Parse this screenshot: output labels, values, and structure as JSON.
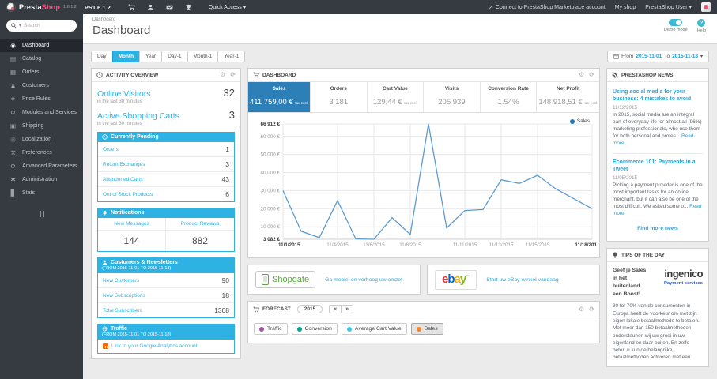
{
  "topbar": {
    "brand_presta": "Presta",
    "brand_shop": "Shop",
    "brand_version": "1.6.1.2",
    "ps_version": "PS1.6.1.2",
    "quick_access_label": "Quick Access ▾",
    "marketplace_link": "Connect to PrestaShop Marketplace account",
    "my_shop_link": "My shop",
    "user_label": "PrestaShop User ▾"
  },
  "sidebar": {
    "search_placeholder": "Search",
    "items": [
      {
        "label": "Dashboard",
        "icon": "gauge-icon",
        "glyph": "◉"
      },
      {
        "label": "Catalog",
        "icon": "book-icon",
        "glyph": "▤"
      },
      {
        "label": "Orders",
        "icon": "orders-icon",
        "glyph": "▦"
      },
      {
        "label": "Customers",
        "icon": "customers-icon",
        "glyph": "♟"
      },
      {
        "label": "Price Rules",
        "icon": "tag-icon",
        "glyph": "❖"
      },
      {
        "label": "Modules and Services",
        "icon": "puzzle-icon",
        "glyph": "⚙"
      },
      {
        "label": "Shipping",
        "icon": "truck-icon",
        "glyph": "▣"
      },
      {
        "label": "Localization",
        "icon": "globe-icon",
        "glyph": "◎"
      },
      {
        "label": "Preferences",
        "icon": "wrench-icon",
        "glyph": "⚒"
      },
      {
        "label": "Advanced Parameters",
        "icon": "gears-icon",
        "glyph": "⚙"
      },
      {
        "label": "Administration",
        "icon": "admin-gear-icon",
        "glyph": "✱"
      },
      {
        "label": "Stats",
        "icon": "stats-icon",
        "glyph": "▊"
      }
    ]
  },
  "header": {
    "breadcrumb": "Dashboard",
    "title": "Dashboard",
    "demo_mode_label": "Demo mode",
    "help_label": "Help"
  },
  "filters": {
    "ranges": [
      "Day",
      "Month",
      "Year",
      "Day-1",
      "Month-1",
      "Year-1"
    ],
    "active_range": "Month",
    "from_label": "From",
    "from_date": "2015-11-01",
    "to_label": "To",
    "to_date": "2015-11-18"
  },
  "activity": {
    "panel_title": "ACTIVITY OVERVIEW",
    "online_visitors_label": "Online Visitors",
    "online_visitors_value": "32",
    "online_visitors_sub": "in the last 30 minutes",
    "active_carts_label": "Active Shopping Carts",
    "active_carts_value": "3",
    "active_carts_sub": "in the last 30 minutes",
    "pending": {
      "title": "Currently Pending",
      "rows": [
        {
          "label": "Orders",
          "value": "1"
        },
        {
          "label": "Return/Exchanges",
          "value": "3"
        },
        {
          "label": "Abandoned Carts",
          "value": "43"
        },
        {
          "label": "Out of Stock Products",
          "value": "6"
        }
      ]
    },
    "notifications": {
      "title": "Notifications",
      "cols": [
        {
          "label": "New Messages",
          "value": "144"
        },
        {
          "label": "Product Reviews",
          "value": "882"
        }
      ]
    },
    "customers": {
      "title": "Customers & Newsletters",
      "subtitle": "(FROM 2015-11-01 TO 2015-11-18)",
      "rows": [
        {
          "label": "New Customers",
          "value": "90"
        },
        {
          "label": "New Subscriptions",
          "value": "18"
        },
        {
          "label": "Total Subscribers",
          "value": "1308"
        }
      ]
    },
    "traffic": {
      "title": "Traffic",
      "subtitle": "(FROM 2015-11-01 TO 2015-11-18)",
      "link": "Link to your Google Analytics account"
    }
  },
  "dashboard_panel": {
    "title": "DASHBOARD",
    "metrics": [
      {
        "label": "Sales",
        "value": "411 759,00 €",
        "suffix": "tax excl.",
        "active": true
      },
      {
        "label": "Orders",
        "value": "3 181",
        "suffix": ""
      },
      {
        "label": "Cart Value",
        "value": "129,44 €",
        "suffix": "tax excl."
      },
      {
        "label": "Visits",
        "value": "205 939",
        "suffix": ""
      },
      {
        "label": "Conversion Rate",
        "value": "1.54%",
        "suffix": ""
      },
      {
        "label": "Net Profit",
        "value": "148 918,51 €",
        "suffix": "tax excl."
      }
    ]
  },
  "chart_data": {
    "type": "line",
    "title": "Sales by day",
    "x": [
      "11/1/2015",
      "11/2/2015",
      "11/3/2015",
      "11/4/2015",
      "11/5/2015",
      "11/6/2015",
      "11/7/2015",
      "11/8/2015",
      "11/9/2015",
      "11/10/2015",
      "11/11/2015",
      "11/12/2015",
      "11/13/2015",
      "11/14/2015",
      "11/15/2015",
      "11/16/2015",
      "11/17/2015",
      "11/18/2015"
    ],
    "series": [
      {
        "name": "Sales",
        "color": "#5b9bd1",
        "values": [
          30000,
          7500,
          4000,
          24500,
          3300,
          3082,
          15000,
          5800,
          66912,
          9300,
          19000,
          19500,
          36000,
          34000,
          38500,
          31000,
          25500,
          20000
        ]
      }
    ],
    "ymin": 3082,
    "ymax": 66912,
    "ytick_values": [
      66912,
      60000,
      50000,
      40000,
      30000,
      20000,
      10000,
      3082
    ],
    "ytick_labels": [
      "66 912 €",
      "60 000 €",
      "50 000 €",
      "40 000 €",
      "30 000 €",
      "20 000 €",
      "10 000 €",
      "3 082 €"
    ],
    "xtick_indices": [
      0,
      3,
      5,
      7,
      10,
      12,
      14,
      17
    ],
    "xtick_labels": [
      "11/1/2015",
      "11/4/2015",
      "11/6/2015",
      "11/8/2015",
      "11/11/2015",
      "11/13/2015",
      "11/15/2015",
      "11/18/201"
    ],
    "grid": true,
    "legend": [
      {
        "label": "Sales",
        "color": "#1f77b4"
      }
    ],
    "legend_position": "top-right"
  },
  "banners": {
    "shopgate_logo": "Shopgate",
    "shopgate_link": "Ga mobiel en verhoog uw omzet",
    "ebay_letters": [
      {
        "ch": "e",
        "color": "#e53238"
      },
      {
        "ch": "b",
        "color": "#0064d2"
      },
      {
        "ch": "a",
        "color": "#f5af02"
      },
      {
        "ch": "y",
        "color": "#86b817"
      }
    ],
    "ebay_tm": "™",
    "ebay_link": "Start uw eBay-winkel vandaag"
  },
  "forecast": {
    "title": "FORECAST",
    "year": "2015",
    "prev_label": "«",
    "next_label": "»",
    "legend": [
      {
        "label": "Traffic",
        "color": "#a0519f",
        "active": false
      },
      {
        "label": "Conversion",
        "color": "#00a28c",
        "active": false
      },
      {
        "label": "Average Cart Value",
        "color": "#3ec6e0",
        "active": false
      },
      {
        "label": "Sales",
        "color": "#f1862b",
        "active": true
      }
    ]
  },
  "news": {
    "panel_title": "PRESTASHOP NEWS",
    "items": [
      {
        "title": "Using social media for your business: 4 mistakes to avoid",
        "date": "11/12/2015",
        "excerpt": "In 2015, social media are an integral part of everyday life for almost all (96%) marketing professionals, who use them for both personal and profes...",
        "read_more": "Read more"
      },
      {
        "title": "Ecommerce 101: Payments in a Tweet",
        "date": "11/05/2015",
        "excerpt": "Picking a payment provider is one of the most important tasks for an online merchant, but it can also be one of the most difficult. We asked some o...",
        "read_more": "Read more"
      }
    ],
    "find_more": "Find more news"
  },
  "tips": {
    "panel_title": "TIPS OF THE DAY",
    "headline": "Geef je Sales in het buitenland een Boost!",
    "logo_main": "ingenico",
    "logo_sub": "Payment services",
    "body": "30 tot 70% van de consumenten in Europa heeft de voorkeur om met zijn eigen lokale betaalmethode te betalen. Met meer dan 150 betaalmethoden, ondersteunen wij uw groei in uw eigenland en daar buiten. En zelfs beter: u kun de belangrijke betaalmethoden activeren met een"
  },
  "colors": {
    "accent_cyan": "#2eb2e4",
    "selected_metric_blue": "#2d7fb7",
    "link_blue": "#2aa6d6",
    "chart_line": "#5b9bd1",
    "topbar_dark": "#363a41"
  }
}
